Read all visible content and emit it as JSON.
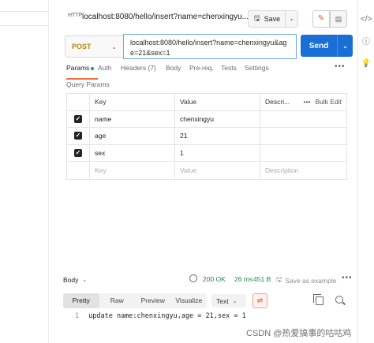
{
  "header": {
    "request_icon": "HTTP",
    "tab_title": "localhost:8080/hello/insert?name=chenxingyu...",
    "save_label": "Save"
  },
  "request": {
    "method": "POST",
    "url": "localhost:8080/hello/insert?name=chenxingyu&age=21&sex=1",
    "send_label": "Send"
  },
  "tabs": [
    "Params",
    "Auth",
    "Headers (7)",
    "Body",
    "Pre-req.",
    "Tests",
    "Settings"
  ],
  "active_tab": "Params",
  "params": {
    "section_title": "Query Params",
    "columns": {
      "key": "Key",
      "value": "Value",
      "description": "Descri...",
      "bulk_edit": "Bulk Edit"
    },
    "rows": [
      {
        "key": "name",
        "value": "chenxingyu",
        "checked": true
      },
      {
        "key": "age",
        "value": "21",
        "checked": true
      },
      {
        "key": "sex",
        "value": "1",
        "checked": true
      }
    ],
    "placeholder": {
      "key": "Key",
      "value": "Value",
      "description": "Description"
    }
  },
  "response": {
    "body_label": "Body",
    "status": "200 OK",
    "time": "26 ms",
    "size": "451 B",
    "save_example": "Save as example",
    "view_tabs": [
      "Pretty",
      "Raw",
      "Preview",
      "Visualize"
    ],
    "active_view": "Pretty",
    "format": "Text",
    "line_number": "1",
    "body_text": "update name:chenxingyu,age = 21,sex = 1"
  },
  "watermark": "CSDN @热爱搞事的咕咕鸡"
}
